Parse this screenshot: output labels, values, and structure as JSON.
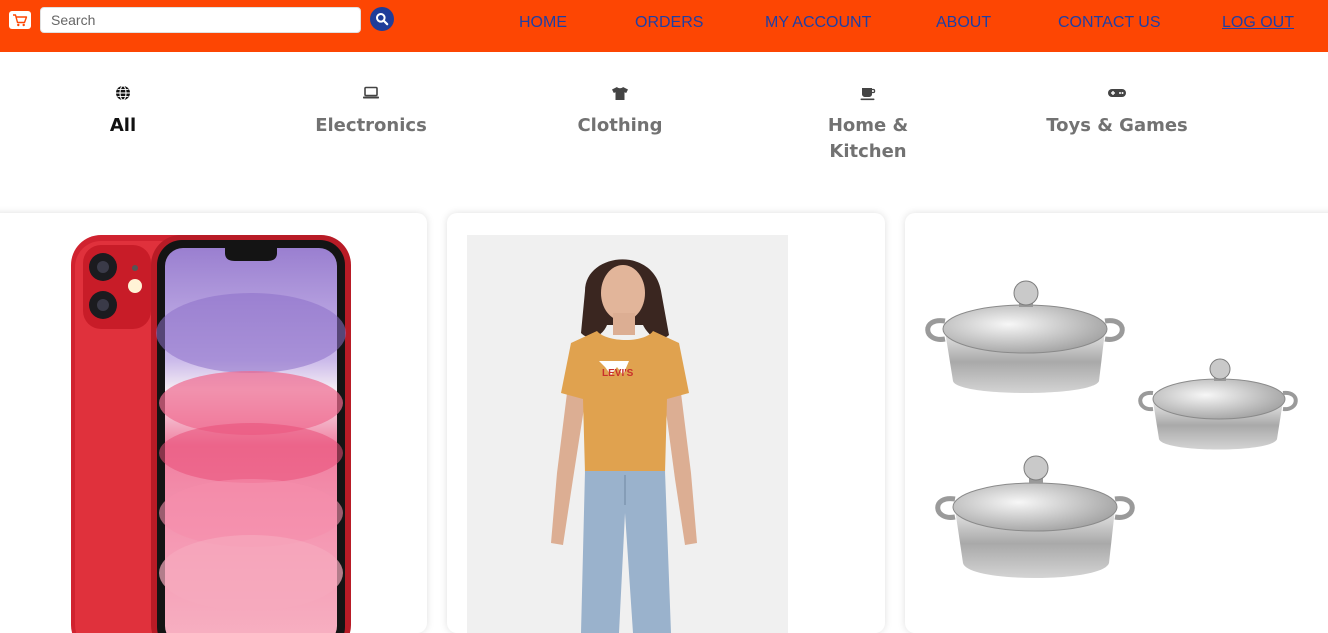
{
  "header": {
    "logo_icon": "shopping-cart-logo-icon",
    "search": {
      "placeholder": "Search",
      "value": ""
    },
    "search_button_icon": "search-icon",
    "nav": [
      {
        "label": "HOME"
      },
      {
        "label": "ORDERS"
      },
      {
        "label": "MY ACCOUNT"
      },
      {
        "label": "ABOUT"
      },
      {
        "label": "CONTACT US"
      },
      {
        "label": "LOG OUT"
      }
    ]
  },
  "categories": [
    {
      "label": "All",
      "icon": "globe-icon",
      "active": true
    },
    {
      "label": "Electronics",
      "icon": "laptop-icon",
      "active": false
    },
    {
      "label": "Clothing",
      "icon": "tshirt-icon",
      "active": false
    },
    {
      "label": "Home &\nKitchen",
      "icon": "coffee-cup-icon",
      "active": false
    },
    {
      "label": "Toys & Games",
      "icon": "gamepad-icon",
      "active": false
    }
  ],
  "products": [
    {
      "image": "red-smartphone-image"
    },
    {
      "image": "orange-levis-tshirt-image",
      "print": "LEVI'S"
    },
    {
      "image": "steel-cooking-pots-image"
    }
  ],
  "colors": {
    "header_bg": "#fd4603",
    "nav_text": "#1e3fa6",
    "search_button": "#1f3d99",
    "active_category": "#111111",
    "inactive_category": "#727272"
  }
}
